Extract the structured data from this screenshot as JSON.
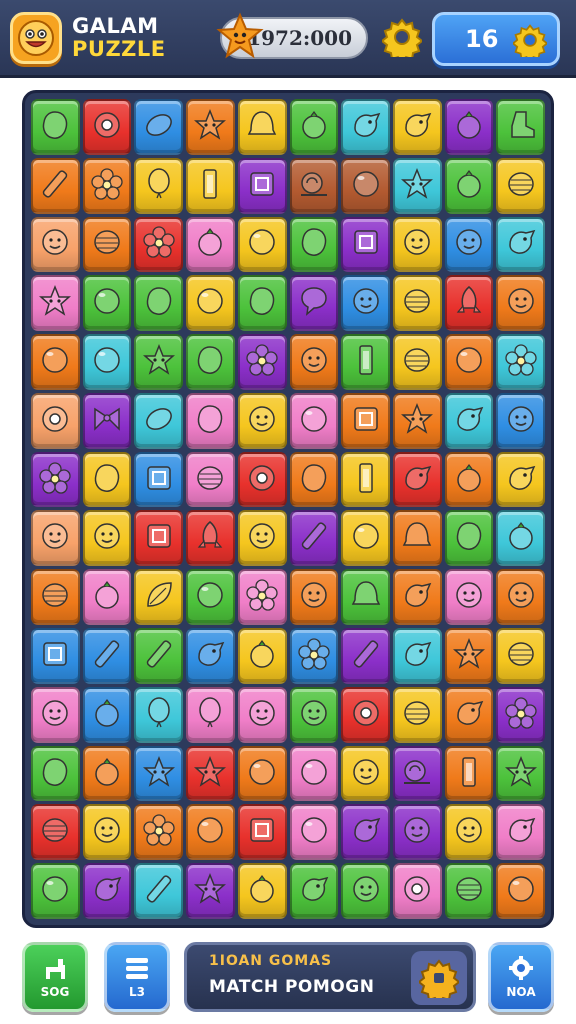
{
  "header": {
    "title_line1": "GALAM",
    "title_line2": "PUZZLE",
    "coins": "1972:000",
    "level": "16",
    "logo_icon": "smiley-face-icon",
    "coin_icon": "star-character-icon",
    "settings_icon": "gear-icon"
  },
  "colors": {
    "green": "#4cc23b",
    "red": "#e8312c",
    "blue": "#2f8ee3",
    "orange": "#f07a1a",
    "yellow": "#f5c61e",
    "purple": "#8b2fc9",
    "pink": "#f07ec8",
    "teal": "#3ec7d9",
    "brown": "#b35a30",
    "peach": "#f8a26a"
  },
  "board": {
    "rows": [
      [
        [
          "green",
          "blob"
        ],
        [
          "red",
          "ring"
        ],
        [
          "blue",
          "bean"
        ],
        [
          "orange",
          "star"
        ],
        [
          "yellow",
          "bell"
        ],
        [
          "green",
          "berry"
        ],
        [
          "teal",
          "bird"
        ],
        [
          "yellow",
          "bird"
        ],
        [
          "purple",
          "berry"
        ],
        [
          "green",
          "boot"
        ]
      ],
      [
        [
          "orange",
          "stick"
        ],
        [
          "orange",
          "flower"
        ],
        [
          "yellow",
          "balloon"
        ],
        [
          "yellow",
          "bar"
        ],
        [
          "purple",
          "square"
        ],
        [
          "brown",
          "snail"
        ],
        [
          "brown",
          "ball"
        ],
        [
          "teal",
          "star"
        ],
        [
          "green",
          "berry"
        ],
        [
          "yellow",
          "shell"
        ]
      ],
      [
        [
          "peach",
          "face"
        ],
        [
          "orange",
          "shell"
        ],
        [
          "red",
          "flower"
        ],
        [
          "pink",
          "berry"
        ],
        [
          "yellow",
          "ball"
        ],
        [
          "green",
          "blob"
        ],
        [
          "purple",
          "square"
        ],
        [
          "yellow",
          "face"
        ],
        [
          "blue",
          "face"
        ],
        [
          "teal",
          "bird"
        ]
      ],
      [
        [
          "pink",
          "star"
        ],
        [
          "green",
          "ball"
        ],
        [
          "green",
          "blob"
        ],
        [
          "yellow",
          "ball"
        ],
        [
          "green",
          "blob"
        ],
        [
          "purple",
          "bubble"
        ],
        [
          "blue",
          "face"
        ],
        [
          "yellow",
          "shell"
        ],
        [
          "red",
          "rocket"
        ],
        [
          "orange",
          "face"
        ]
      ],
      [
        [
          "orange",
          "ball"
        ],
        [
          "teal",
          "ball"
        ],
        [
          "green",
          "star"
        ],
        [
          "green",
          "blob"
        ],
        [
          "purple",
          "flower"
        ],
        [
          "orange",
          "face"
        ],
        [
          "green",
          "bar"
        ],
        [
          "yellow",
          "shell"
        ],
        [
          "orange",
          "ball"
        ],
        [
          "teal",
          "flower"
        ]
      ],
      [
        [
          "peach",
          "ring"
        ],
        [
          "purple",
          "bow"
        ],
        [
          "teal",
          "bean"
        ],
        [
          "pink",
          "blob"
        ],
        [
          "yellow",
          "face"
        ],
        [
          "pink",
          "ball"
        ],
        [
          "orange",
          "square"
        ],
        [
          "orange",
          "star"
        ],
        [
          "teal",
          "bird"
        ],
        [
          "blue",
          "face"
        ]
      ],
      [
        [
          "purple",
          "flower"
        ],
        [
          "yellow",
          "blob"
        ],
        [
          "blue",
          "square"
        ],
        [
          "pink",
          "shell"
        ],
        [
          "red",
          "ring"
        ],
        [
          "orange",
          "blob"
        ],
        [
          "yellow",
          "bar"
        ],
        [
          "red",
          "bird"
        ],
        [
          "orange",
          "berry"
        ],
        [
          "yellow",
          "bird"
        ]
      ],
      [
        [
          "peach",
          "face"
        ],
        [
          "yellow",
          "face"
        ],
        [
          "red",
          "square"
        ],
        [
          "red",
          "rocket"
        ],
        [
          "yellow",
          "face"
        ],
        [
          "purple",
          "stick"
        ],
        [
          "yellow",
          "ball"
        ],
        [
          "orange",
          "bell"
        ],
        [
          "green",
          "blob"
        ],
        [
          "teal",
          "berry"
        ]
      ],
      [
        [
          "orange",
          "shell"
        ],
        [
          "pink",
          "berry"
        ],
        [
          "yellow",
          "leaf"
        ],
        [
          "green",
          "ball"
        ],
        [
          "pink",
          "flower"
        ],
        [
          "orange",
          "face"
        ],
        [
          "green",
          "bell"
        ],
        [
          "orange",
          "bird"
        ],
        [
          "pink",
          "face"
        ],
        [
          "orange",
          "face"
        ]
      ],
      [
        [
          "blue",
          "square"
        ],
        [
          "blue",
          "stick"
        ],
        [
          "green",
          "stick"
        ],
        [
          "blue",
          "bird"
        ],
        [
          "yellow",
          "berry"
        ],
        [
          "blue",
          "flower"
        ],
        [
          "purple",
          "stick"
        ],
        [
          "teal",
          "bird"
        ],
        [
          "orange",
          "star"
        ],
        [
          "yellow",
          "shell"
        ]
      ],
      [
        [
          "pink",
          "face"
        ],
        [
          "blue",
          "berry"
        ],
        [
          "teal",
          "balloon"
        ],
        [
          "pink",
          "balloon"
        ],
        [
          "pink",
          "face"
        ],
        [
          "green",
          "face"
        ],
        [
          "red",
          "ring"
        ],
        [
          "yellow",
          "shell"
        ],
        [
          "orange",
          "bird"
        ],
        [
          "purple",
          "flower"
        ]
      ],
      [
        [
          "green",
          "blob"
        ],
        [
          "orange",
          "berry"
        ],
        [
          "blue",
          "star"
        ],
        [
          "red",
          "star"
        ],
        [
          "orange",
          "ball"
        ],
        [
          "pink",
          "ball"
        ],
        [
          "yellow",
          "face"
        ],
        [
          "purple",
          "snail"
        ],
        [
          "orange",
          "bar"
        ],
        [
          "green",
          "star"
        ]
      ],
      [
        [
          "red",
          "shell"
        ],
        [
          "yellow",
          "face"
        ],
        [
          "orange",
          "flower"
        ],
        [
          "orange",
          "ball"
        ],
        [
          "red",
          "square"
        ],
        [
          "pink",
          "ball"
        ],
        [
          "purple",
          "bird"
        ],
        [
          "purple",
          "face"
        ],
        [
          "yellow",
          "face"
        ],
        [
          "pink",
          "bird"
        ]
      ],
      [
        [
          "green",
          "ball"
        ],
        [
          "purple",
          "bird"
        ],
        [
          "teal",
          "stick"
        ],
        [
          "purple",
          "star"
        ],
        [
          "yellow",
          "berry"
        ],
        [
          "green",
          "bird"
        ],
        [
          "green",
          "face"
        ],
        [
          "pink",
          "ring"
        ],
        [
          "green",
          "shell"
        ],
        [
          "orange",
          "ball"
        ]
      ]
    ]
  },
  "footer": {
    "btn1_label": "SOG",
    "btn1_icon": "llama-icon",
    "btn2_label": "L3",
    "btn2_icon": "list-icon",
    "banner_line1": "1IOAN GOMAS",
    "banner_line2": "MATCH POMOGN",
    "banner_icon": "gear-puzzle-icon",
    "btn3_label": "NOA",
    "btn3_icon": "gear-icon"
  }
}
